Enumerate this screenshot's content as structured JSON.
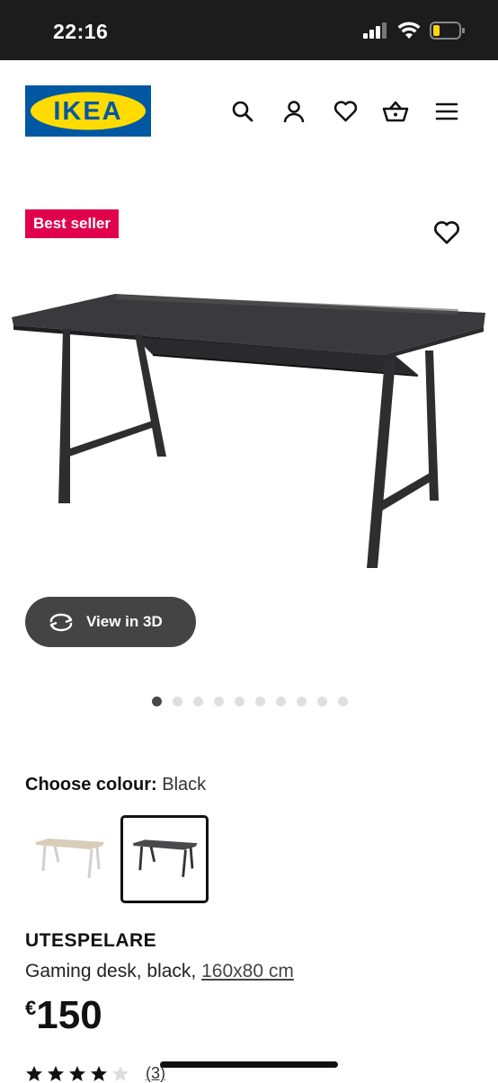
{
  "status_bar": {
    "time": "22:16"
  },
  "header": {
    "logo_text": "IKEA",
    "colors": {
      "logo_blue": "#0058a3",
      "logo_yellow": "#ffdb00"
    },
    "icons": [
      "search-icon",
      "user-icon",
      "heart-icon",
      "basket-icon",
      "menu-icon"
    ]
  },
  "product": {
    "badge": "Best seller",
    "badge_color": "#e0004d",
    "view3d_label": "View in 3D",
    "carousel": {
      "total": 10,
      "active": 1
    },
    "colour_label": "Choose colour:",
    "colour_value": "Black",
    "swatches": [
      "beige-white-desk",
      "black-desk"
    ],
    "name": "UTESPELARE",
    "description": "Gaming desk, black,",
    "size": "160x80 cm",
    "price_currency": "€",
    "price_amount": "150",
    "rating_stars": 4,
    "rating_max": 5,
    "rating_count": "(3)"
  }
}
